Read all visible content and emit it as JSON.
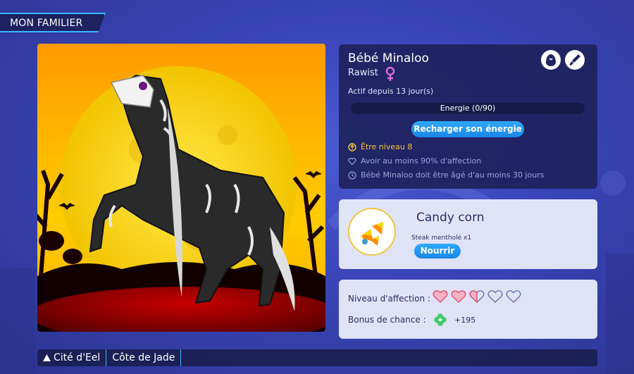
{
  "header": {
    "title": "MON FAMILIER"
  },
  "pet": {
    "name": "Bébé Minaloo",
    "breed": "Rawist",
    "gender_icon": "female-symbol",
    "active_since": "Actif depuis 13 jour(s)",
    "energy_text": "Energie (0/90)",
    "energy_fraction": 0,
    "recharge_label": "Recharger son énergie"
  },
  "requirements": {
    "level": "Être niveau 8",
    "affection": "Avoir au moins 90% d'affection",
    "age": "Bébé Minaloo doit être âgé d'au moins 30 jours"
  },
  "food": {
    "name": "Candy corn",
    "item": "Steak mentholé x1",
    "feed_label": "Nourrir"
  },
  "stats": {
    "affection_label": "Niveau d'affection :",
    "affection_hearts": {
      "filled": 2,
      "partial": 1,
      "total": 5
    },
    "bonus_label": "Bonus de chance :",
    "bonus_value": "+195"
  },
  "breadcrumb": {
    "items": [
      "Cité d'Eel",
      "Côte de Jade"
    ]
  },
  "colors": {
    "accent_blue": "#1a86e6",
    "heart_pink": "#f06a8a",
    "gold": "#f5c542",
    "female_pink": "#e06ad8"
  }
}
